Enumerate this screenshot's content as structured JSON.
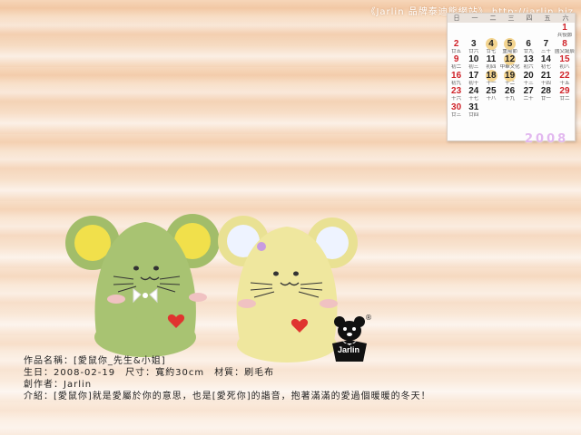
{
  "banner": "《Jarlin 品牌泰迪熊網站》 http://jarlin.biz",
  "calendar": {
    "weekdays": [
      "日",
      "一",
      "二",
      "三",
      "四",
      "五",
      "六"
    ],
    "year": "2008",
    "rows": [
      [
        {
          "d": "",
          "l": ""
        },
        {
          "d": "",
          "l": ""
        },
        {
          "d": "",
          "l": ""
        },
        {
          "d": "",
          "l": ""
        },
        {
          "d": "",
          "l": ""
        },
        {
          "d": "",
          "l": ""
        },
        {
          "d": "1",
          "l": "兵役節"
        }
      ],
      [
        {
          "d": "2",
          "l": "廿五"
        },
        {
          "d": "3",
          "l": "廿六"
        },
        {
          "d": "4",
          "l": "廿七"
        },
        {
          "d": "5",
          "l": "重陽節"
        },
        {
          "d": "6",
          "l": "廿九"
        },
        {
          "d": "7",
          "l": "三十"
        },
        {
          "d": "8",
          "l": "國父誕辰"
        }
      ],
      [
        {
          "d": "9",
          "l": "初二"
        },
        {
          "d": "10",
          "l": "初三"
        },
        {
          "d": "11",
          "l": "初四"
        },
        {
          "d": "12",
          "l": "中華文化"
        },
        {
          "d": "13",
          "l": "初六"
        },
        {
          "d": "14",
          "l": "初七"
        },
        {
          "d": "15",
          "l": "初八"
        }
      ],
      [
        {
          "d": "16",
          "l": "初九"
        },
        {
          "d": "17",
          "l": "初十"
        },
        {
          "d": "18",
          "l": "十一"
        },
        {
          "d": "19",
          "l": "十二"
        },
        {
          "d": "20",
          "l": "十三"
        },
        {
          "d": "21",
          "l": "十四"
        },
        {
          "d": "22",
          "l": "十五"
        }
      ],
      [
        {
          "d": "23",
          "l": "十六"
        },
        {
          "d": "24",
          "l": "十七"
        },
        {
          "d": "25",
          "l": "十八"
        },
        {
          "d": "26",
          "l": "十九"
        },
        {
          "d": "27",
          "l": "二十"
        },
        {
          "d": "28",
          "l": "廿一"
        },
        {
          "d": "29",
          "l": "廿二"
        }
      ],
      [
        {
          "d": "30",
          "l": "廿三"
        },
        {
          "d": "31",
          "l": "廿四"
        },
        {
          "d": "",
          "l": ""
        },
        {
          "d": "",
          "l": ""
        },
        {
          "d": "",
          "l": ""
        },
        {
          "d": "",
          "l": ""
        },
        {
          "d": "",
          "l": ""
        }
      ]
    ]
  },
  "logo": {
    "text": "Jarlin",
    "registered": "®"
  },
  "info": {
    "line1": "作品名稱：[愛鼠你_先生&小姐]",
    "line2": "生日：2008-02-19　尺寸：寬約30cm　材質：刷毛布",
    "line3": "創作者：Jarlin",
    "line4": "介紹：[愛鼠你]就是愛屬於你的意思，也是[愛死你]的諧音，抱著滿滿的愛過個暖暖的冬天！"
  },
  "colors": {
    "green_toy": "#a6c070",
    "yellow_toy": "#efe79a",
    "heart": "#e0342f",
    "accent_year": "#e2b8ef"
  }
}
